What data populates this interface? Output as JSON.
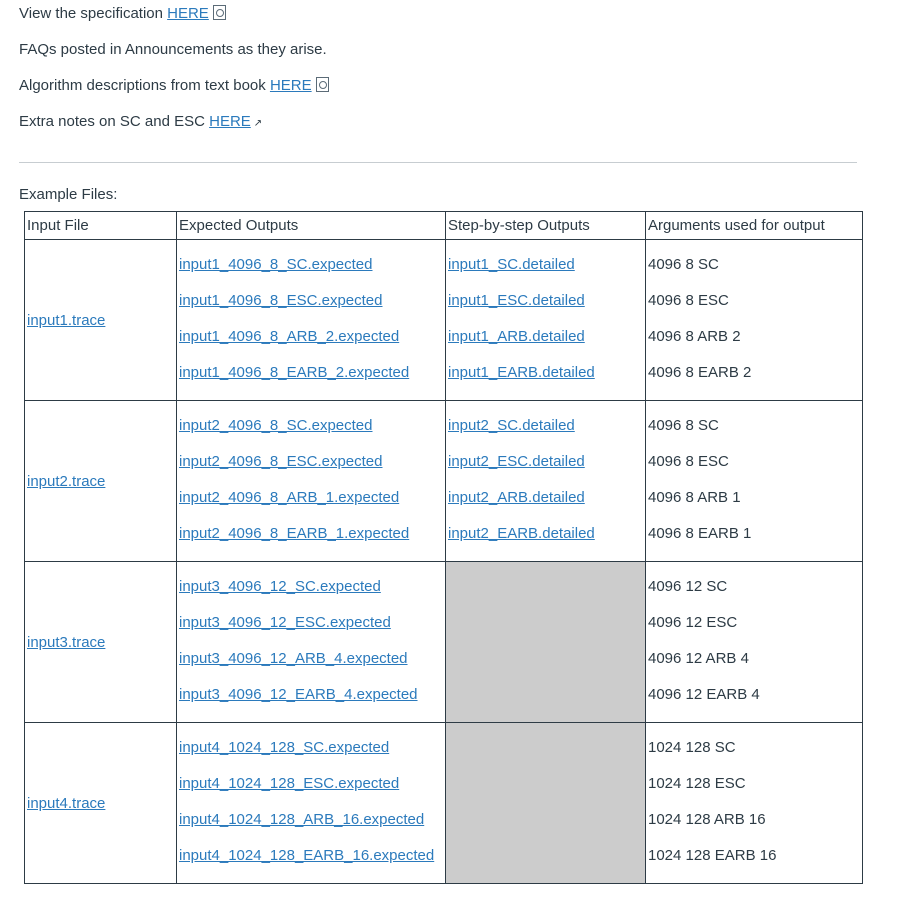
{
  "intro": {
    "spec_text": "View the specification ",
    "spec_link": "HERE",
    "faq_text": "FAQs posted in Announcements as they arise.",
    "algo_text": "Algorithm descriptions from text book ",
    "algo_link": "HERE",
    "notes_text": "Extra notes on SC and ESC ",
    "notes_link": "HERE"
  },
  "example_label": "Example Files:",
  "table": {
    "headers": [
      "Input File",
      "Expected Outputs",
      "Step-by-step Outputs",
      "Arguments used for output"
    ],
    "rows": [
      {
        "input": "input1.trace",
        "expected": [
          "input1_4096_8_SC.expected",
          "input1_4096_8_ESC.expected",
          "input1_4096_8_ARB_2.expected",
          "input1_4096_8_EARB_2.expected"
        ],
        "detailed": [
          "input1_SC.detailed",
          "input1_ESC.detailed",
          "input1_ARB.detailed",
          "input1_EARB.detailed"
        ],
        "args": [
          "4096 8 SC",
          "4096 8 ESC",
          "4096 8 ARB 2",
          "4096 8 EARB 2"
        ]
      },
      {
        "input": "input2.trace",
        "expected": [
          "input2_4096_8_SC.expected",
          "input2_4096_8_ESC.expected",
          "input2_4096_8_ARB_1.expected",
          "input2_4096_8_EARB_1.expected"
        ],
        "detailed": [
          "input2_SC.detailed",
          "input2_ESC.detailed",
          "input2_ARB.detailed",
          "input2_EARB.detailed"
        ],
        "args": [
          "4096 8 SC",
          "4096 8 ESC",
          "4096 8 ARB 1",
          "4096 8 EARB 1"
        ]
      },
      {
        "input": "input3.trace",
        "expected": [
          "input3_4096_12_SC.expected",
          "input3_4096_12_ESC.expected",
          "input3_4096_12_ARB_4.expected",
          "input3_4096_12_EARB_4.expected"
        ],
        "detailed": [],
        "args": [
          "4096 12 SC",
          "4096 12 ESC",
          "4096 12 ARB 4",
          "4096 12 EARB 4"
        ]
      },
      {
        "input": "input4.trace",
        "expected": [
          "input4_1024_128_SC.expected",
          "input4_1024_128_ESC.expected",
          "input4_1024_128_ARB_16.expected",
          "input4_1024_128_EARB_16.expected"
        ],
        "detailed": [],
        "args": [
          "1024 128 SC",
          "1024 128 ESC",
          "1024 128 ARB 16",
          "1024 128 EARB 16"
        ]
      }
    ]
  },
  "icons": {
    "spec": "document-icon",
    "algo": "document-icon",
    "notes": "external-link-icon"
  },
  "colors": {
    "link": "#2b7abc",
    "text": "#2d3b45",
    "empty_cell": "#cccccc"
  }
}
